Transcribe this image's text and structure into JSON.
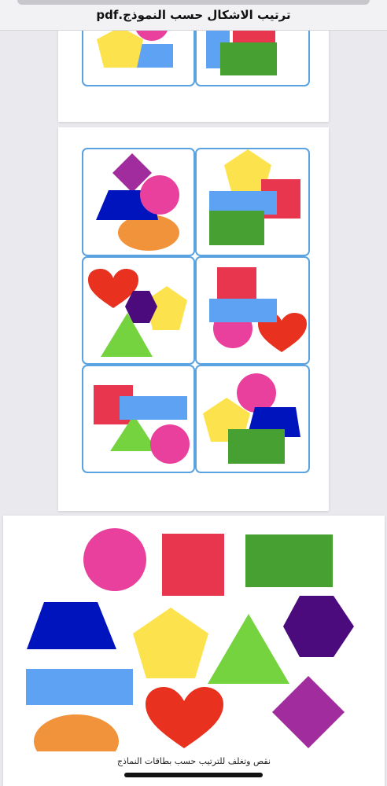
{
  "window": {
    "title": "ترتيب الاشكال حسب النموذج.pdf"
  },
  "colors": {
    "card_border": "#5aa2e0",
    "pink": "#e8409c",
    "red": "#e8364e",
    "green": "#47a032",
    "lightblue": "#5ea2f3",
    "yellow": "#fce34d",
    "blue": "#0014be",
    "purple": "#a12c9e",
    "darkpurple": "#4b0b7c",
    "lightgreen": "#76d340",
    "orange": "#f1933a",
    "heartred": "#e8311e"
  },
  "pages": {
    "page1": {
      "cards": [
        {
          "shapes": [
            "pentagon-yellow",
            "circle-pink",
            "rectangle-lightblue"
          ]
        },
        {
          "shapes": [
            "rectangle-red",
            "rectangle-lightblue",
            "rectangle-green"
          ]
        }
      ]
    },
    "page2": {
      "cards": [
        {
          "shapes": [
            "diamond-purple",
            "circle-pink",
            "trapezoid-blue",
            "ellipse-orange"
          ]
        },
        {
          "shapes": [
            "pentagon-yellow",
            "square-red",
            "rectangle-lightblue",
            "rectangle-green"
          ]
        },
        {
          "shapes": [
            "heart-red",
            "hexagon-darkpurple",
            "pentagon-yellow",
            "triangle-lightgreen"
          ]
        },
        {
          "shapes": [
            "square-red",
            "rectangle-lightblue",
            "circle-pink",
            "heart-red"
          ]
        },
        {
          "shapes": [
            "square-red",
            "rectangle-lightblue",
            "triangle-lightgreen",
            "circle-pink"
          ]
        },
        {
          "shapes": [
            "circle-pink",
            "pentagon-yellow",
            "trapezoid-blue",
            "rectangle-green"
          ]
        }
      ]
    },
    "page3": {
      "cutout_shapes": [
        "circle-pink",
        "square-red",
        "rectangle-green",
        "trapezoid-blue",
        "pentagon-yellow",
        "triangle-lightgreen",
        "hexagon-darkpurple",
        "rectangle-lightblue",
        "heart-red",
        "diamond-purple",
        "ellipse-orange"
      ],
      "caption": "نقص وتغلف للترتيب حسب بطاقات النماذج"
    }
  }
}
